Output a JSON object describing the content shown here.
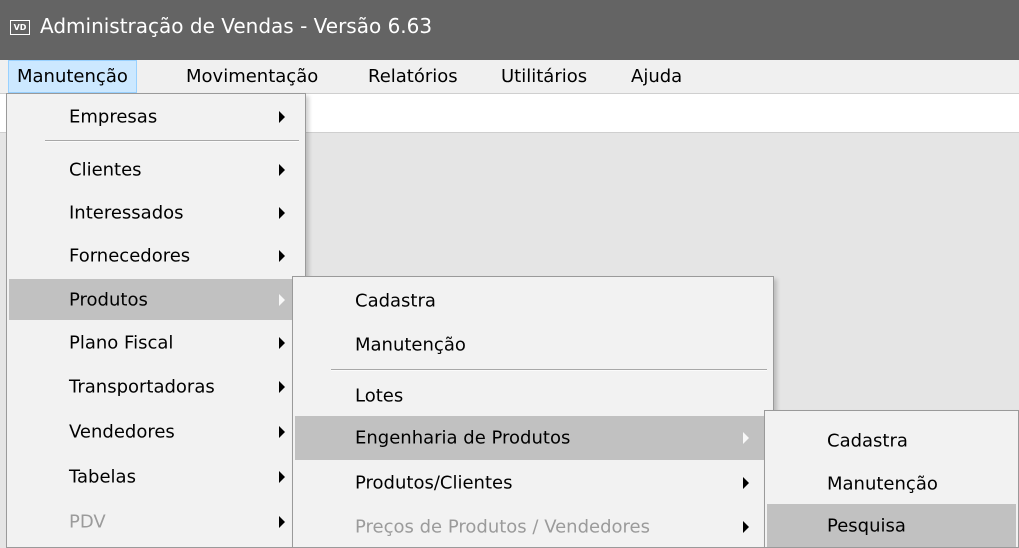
{
  "window": {
    "icon_text": "VD",
    "title": "Administração de Vendas - Versão 6.63"
  },
  "menubar": {
    "items": [
      "Manutenção",
      "Movimentação",
      "Relatórios",
      "Utilitários",
      "Ajuda"
    ],
    "active": "Manutenção"
  },
  "manutencao_menu": {
    "items": [
      {
        "label": "Empresas",
        "submenu": true
      },
      {
        "label": "Clientes",
        "submenu": true
      },
      {
        "label": "Interessados",
        "submenu": true
      },
      {
        "label": "Fornecedores",
        "submenu": true
      },
      {
        "label": "Produtos",
        "submenu": true,
        "highlighted": true
      },
      {
        "label": "Plano Fiscal",
        "submenu": true
      },
      {
        "label": "Transportadoras",
        "submenu": true
      },
      {
        "label": "Vendedores",
        "submenu": true
      },
      {
        "label": "Tabelas",
        "submenu": true
      },
      {
        "label": "PDV",
        "submenu": true,
        "disabled": true
      }
    ]
  },
  "produtos_menu": {
    "items": [
      {
        "label": "Cadastra"
      },
      {
        "label": "Manutenção"
      },
      {
        "label": "Lotes"
      },
      {
        "label": "Engenharia de Produtos",
        "submenu": true,
        "highlighted": true
      },
      {
        "label": "Produtos/Clientes",
        "submenu": true
      },
      {
        "label": "Preços de Produtos / Vendedores",
        "submenu": true,
        "disabled": true
      }
    ]
  },
  "engenharia_menu": {
    "items": [
      {
        "label": "Cadastra"
      },
      {
        "label": "Manutenção"
      },
      {
        "label": "Pesquisa",
        "highlighted": true
      }
    ]
  }
}
